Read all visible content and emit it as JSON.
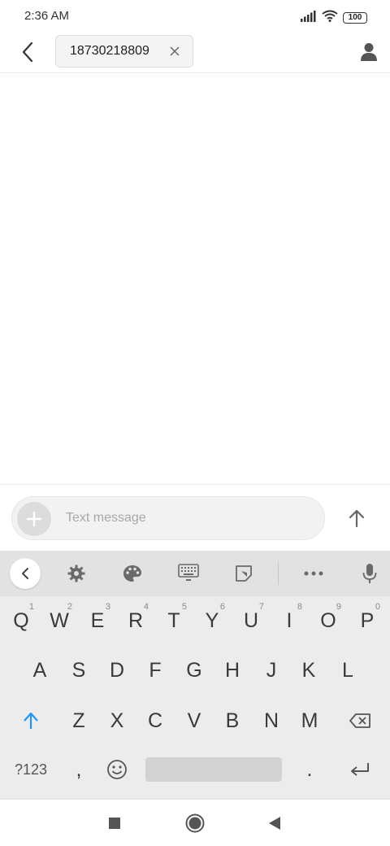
{
  "status_bar": {
    "time": "2:36 AM",
    "battery": "100",
    "icons": [
      "signal-icon",
      "wifi-icon",
      "battery-icon"
    ]
  },
  "header": {
    "back_icon": "chevron-left-icon",
    "recipient": "18730218809",
    "remove_icon": "close-icon",
    "contact_icon": "person-icon"
  },
  "compose": {
    "add_icon": "plus-icon",
    "placeholder": "Text message",
    "send_icon": "arrow-up-icon"
  },
  "keyboard": {
    "toolbar_icons": [
      "chevron-left-icon",
      "gear-icon",
      "palette-icon",
      "keyboard-icon",
      "sticker-icon",
      "more-icon",
      "mic-icon"
    ],
    "row1": [
      {
        "k": "Q",
        "h": "1"
      },
      {
        "k": "W",
        "h": "2"
      },
      {
        "k": "E",
        "h": "3"
      },
      {
        "k": "R",
        "h": "4"
      },
      {
        "k": "T",
        "h": "5"
      },
      {
        "k": "Y",
        "h": "6"
      },
      {
        "k": "U",
        "h": "7"
      },
      {
        "k": "I",
        "h": "8"
      },
      {
        "k": "O",
        "h": "9"
      },
      {
        "k": "P",
        "h": "0"
      }
    ],
    "row2": [
      "A",
      "S",
      "D",
      "F",
      "G",
      "H",
      "J",
      "K",
      "L"
    ],
    "row3": [
      "Z",
      "X",
      "C",
      "V",
      "B",
      "N",
      "M"
    ],
    "symbols_label": "?123",
    "comma": ",",
    "period": "."
  },
  "colors": {
    "accent": "#2196F3",
    "keyboard_bg": "#ececec",
    "toolbar_bg": "#e2e2e2"
  }
}
